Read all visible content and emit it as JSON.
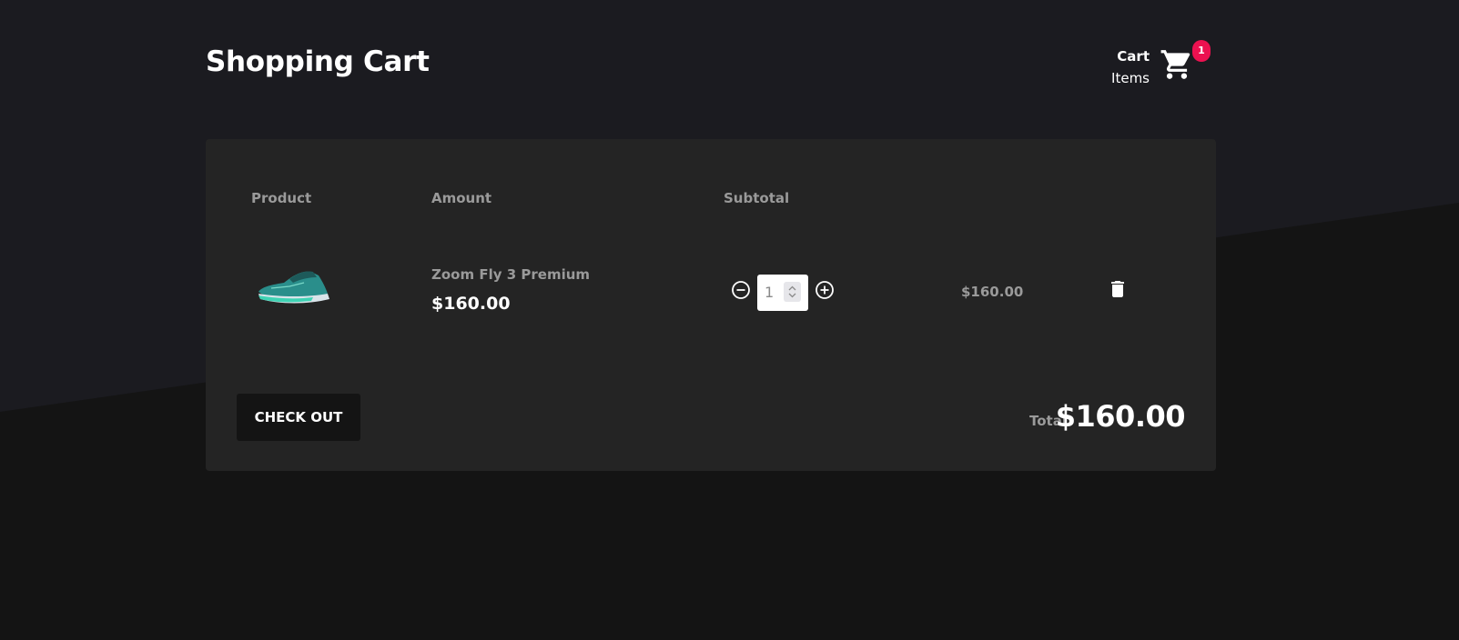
{
  "header": {
    "title": "Shopping Cart",
    "cart_label_line1": "Cart",
    "cart_label_line2": "Items",
    "cart_count": "1",
    "cart_icon": "shopping-cart-icon",
    "badge_color": "#ec1150"
  },
  "table": {
    "columns": [
      "Product",
      "Amount",
      "Subtotal"
    ],
    "rows": [
      {
        "image": "running-shoe-image",
        "name": "Zoom Fly 3 Premium",
        "price": "$160.00",
        "quantity": "1",
        "subtotal": "$160.00"
      }
    ]
  },
  "footer": {
    "checkout_label": "CHECK OUT",
    "total_label": "Total",
    "total_value": "$160.00"
  },
  "colors": {
    "page_background": "#141414",
    "panel_background": "#242424",
    "muted_text": "#9a9a9a"
  }
}
